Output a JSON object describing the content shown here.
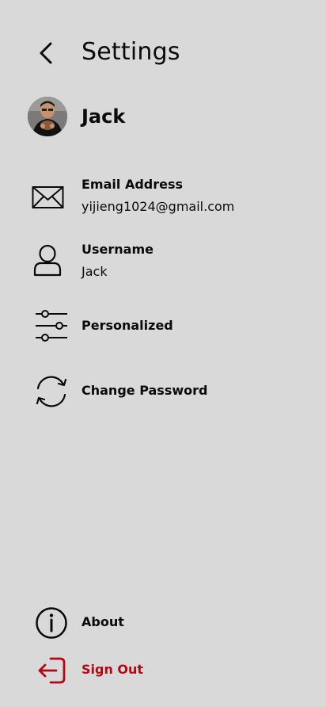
{
  "header": {
    "title": "Settings",
    "back_icon": "chevron-left-icon"
  },
  "profile": {
    "name": "Jack",
    "avatar_icon": "user-avatar-photo"
  },
  "items": [
    {
      "icon": "mail-icon",
      "label": "Email Address",
      "value": "yijieng1024@gmail.com"
    },
    {
      "icon": "user-icon",
      "label": "Username",
      "value": "Jack"
    },
    {
      "icon": "sliders-icon",
      "label": "Personalized"
    },
    {
      "icon": "refresh-icon",
      "label": "Change Password"
    }
  ],
  "footer": {
    "about": {
      "icon": "info-icon",
      "label": "About"
    },
    "sign_out": {
      "icon": "logout-icon",
      "label": "Sign Out"
    }
  },
  "colors": {
    "background": "#d9d9d9",
    "text": "#0a0a0a",
    "danger": "#b20a12"
  }
}
